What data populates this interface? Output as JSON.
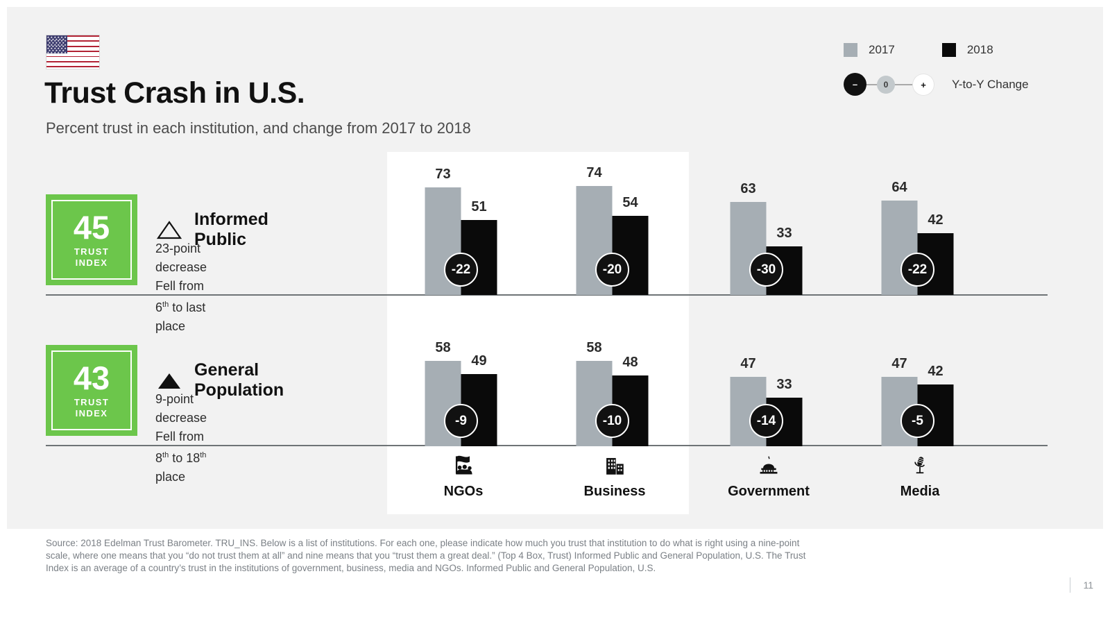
{
  "header": {
    "flag_icon": "us-flag-icon",
    "title": "Trust Crash in U.S.",
    "subtitle": "Percent trust in each institution, and change from 2017 to 2018"
  },
  "legend": {
    "prev_year": "2017",
    "curr_year": "2018",
    "prev_color": "#a6aeb4",
    "curr_color": "#0a0a0a",
    "scale": {
      "minus": "–",
      "zero": "0",
      "plus": "+",
      "caption": "Y-to-Y Change"
    }
  },
  "audiences": [
    {
      "index_value": "45",
      "index_caption_line1": "TRUST",
      "index_caption_line2": "INDEX",
      "icon": "triangle-outline-icon",
      "name": "Informed Public",
      "detail_line1": "23-point decrease",
      "detail_line2_pre": "Fell from 6",
      "detail_line2_sup": "th",
      "detail_line2_post": " to last place",
      "box_color": "#6cc64b"
    },
    {
      "index_value": "43",
      "index_caption_line1": "TRUST",
      "index_caption_line2": "INDEX",
      "icon": "triangle-filled-icon",
      "name": "General Population",
      "detail_line1": "9-point decrease",
      "detail_line2_pre": "Fell from 8",
      "detail_line2_sup": "th",
      "detail_line2_mid": " to 18",
      "detail_line2_sup2": "th",
      "detail_line2_post": " place",
      "box_color": "#6cc64b"
    }
  ],
  "chart_data": {
    "type": "bar",
    "title": "Trust Crash in U.S.",
    "subtitle": "Percent trust in each institution, and change from 2017 to 2018",
    "categories": [
      "NGOs",
      "Business",
      "Government",
      "Media"
    ],
    "category_icons": [
      "ngo-flag-icon",
      "business-building-icon",
      "government-capitol-icon",
      "media-microphone-icon"
    ],
    "ylim": [
      0,
      100
    ],
    "grid": false,
    "legend_position": "top-right",
    "rows": [
      {
        "audience": "Informed Public",
        "series": [
          {
            "name": "2017",
            "values": [
              73,
              74,
              63,
              64
            ]
          },
          {
            "name": "2018",
            "values": [
              51,
              54,
              33,
              42
            ]
          }
        ],
        "deltas": [
          "-22",
          "-20",
          "-30",
          "-22"
        ]
      },
      {
        "audience": "General Population",
        "series": [
          {
            "name": "2017",
            "values": [
              58,
              58,
              47,
              47
            ]
          },
          {
            "name": "2018",
            "values": [
              49,
              48,
              33,
              42
            ]
          }
        ],
        "deltas": [
          "-9",
          "-10",
          "-14",
          "-5"
        ]
      }
    ]
  },
  "footer": {
    "source": "Source: 2018 Edelman Trust Barometer. TRU_INS. Below is a list of institutions. For each one, please indicate how much you trust that institution to do what is right using a nine-point scale, where one means that you “do not trust them at all” and nine means that you “trust them a great deal.” (Top 4 Box, Trust) Informed Public and General Population, U.S. The Trust Index is an average of a country’s trust in the institutions of government, business, media and NGOs. Informed Public and General Population, U.S.",
    "page_number": "11"
  }
}
